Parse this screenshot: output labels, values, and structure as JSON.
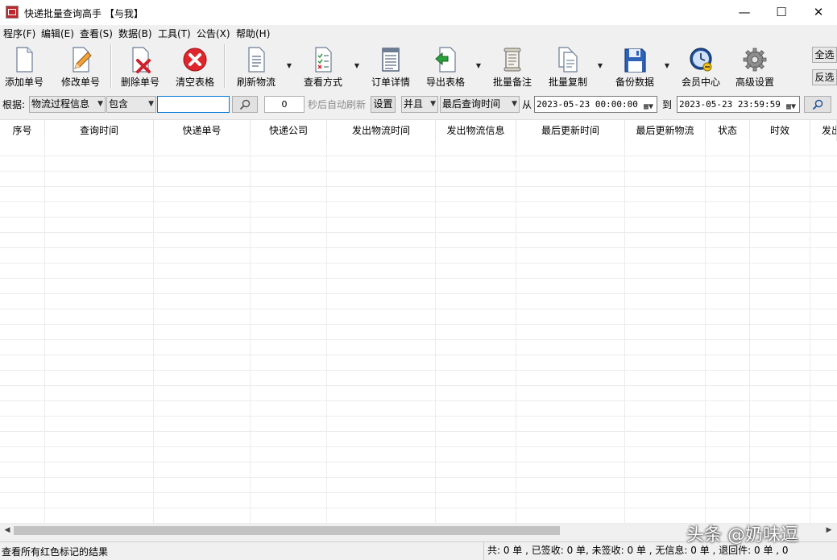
{
  "window": {
    "title": "快递批量查询高手 【与我】",
    "minimize": "—",
    "maximize": "☐",
    "close": "✕"
  },
  "menu": [
    "程序(F)",
    "编辑(E)",
    "查看(S)",
    "数据(B)",
    "工具(T)",
    "公告(X)",
    "帮助(H)"
  ],
  "toolbar": {
    "buttons": [
      {
        "label": "添加单号",
        "icon": "document-add-icon"
      },
      {
        "label": "修改单号",
        "icon": "pencil-edit-icon"
      },
      {
        "label": "删除单号",
        "icon": "document-delete-icon"
      },
      {
        "label": "清空表格",
        "icon": "red-x-icon"
      },
      {
        "label": "刷新物流",
        "icon": "refresh-document-icon"
      },
      {
        "label": "查看方式",
        "icon": "checklist-icon"
      },
      {
        "label": "订单详情",
        "icon": "details-icon"
      },
      {
        "label": "导出表格",
        "icon": "export-icon"
      },
      {
        "label": "批量备注",
        "icon": "scroll-note-icon"
      },
      {
        "label": "批量复制",
        "icon": "copy-icon"
      },
      {
        "label": "备份数据",
        "icon": "floppy-disk-icon"
      },
      {
        "label": "会员中心",
        "icon": "clock-icon"
      },
      {
        "label": "高级设置",
        "icon": "gear-icon"
      }
    ],
    "select_all": "全选",
    "invert_selection": "反选"
  },
  "filter": {
    "basis_label": "根据:",
    "basis_value": "物流过程信息",
    "match_value": "包含",
    "search_value": "",
    "refresh_seconds": "0",
    "auto_refresh_text": "秒后自动刷新",
    "settings_button": "设置",
    "logic_value": "并且",
    "time_field_value": "最后查询时间",
    "from_label": "从",
    "from_datetime": "2023-05-23 00:00:00",
    "to_label": "到",
    "to_datetime": "2023-05-23 23:59:59"
  },
  "table": {
    "columns": [
      "序号",
      "查询时间",
      "快递单号",
      "快递公司",
      "发出物流时间",
      "发出物流信息",
      "最后更新时间",
      "最后更新物流",
      "状态",
      "时效",
      "发出"
    ]
  },
  "status": {
    "left": "查看所有红色标记的结果",
    "right": "共: 0 单 , 已签收:  0 单, 未签收:  0 单 , 无信息: 0 单 , 退回件: 0 单 ,  0"
  },
  "watermark": "头条 @奶味逗"
}
